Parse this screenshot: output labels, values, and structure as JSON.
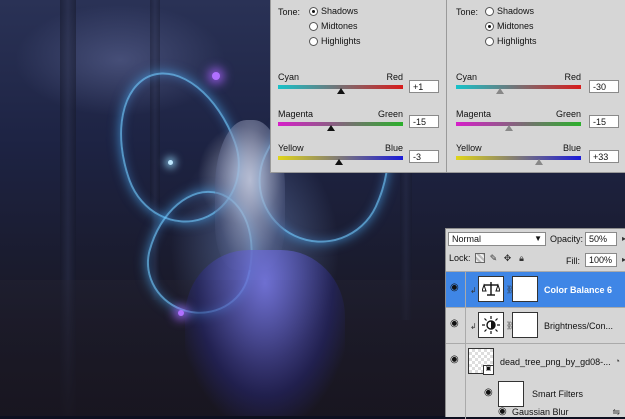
{
  "color_balance_left": {
    "tone_label": "Tone:",
    "tones": [
      {
        "label": "Shadows",
        "selected": true
      },
      {
        "label": "Midtones",
        "selected": false
      },
      {
        "label": "Highlights",
        "selected": false
      }
    ],
    "sliders": [
      {
        "left": "Cyan",
        "right": "Red",
        "value": "+1",
        "level_percent": 50.5
      },
      {
        "left": "Magenta",
        "right": "Green",
        "value": "-15",
        "level_percent": 42.5
      },
      {
        "left": "Yellow",
        "right": "Blue",
        "value": "-3",
        "level_percent": 48.5
      }
    ]
  },
  "color_balance_right": {
    "tone_label": "Tone:",
    "tones": [
      {
        "label": "Shadows",
        "selected": false
      },
      {
        "label": "Midtones",
        "selected": true
      },
      {
        "label": "Highlights",
        "selected": false
      }
    ],
    "sliders": [
      {
        "left": "Cyan",
        "right": "Red",
        "value": "-30",
        "level_percent": 35
      },
      {
        "left": "Magenta",
        "right": "Green",
        "value": "-15",
        "level_percent": 42.5
      },
      {
        "left": "Yellow",
        "right": "Blue",
        "value": "+33",
        "level_percent": 66.5
      }
    ]
  },
  "layers_panel": {
    "blend_mode": "Normal",
    "opacity_label": "Opacity:",
    "opacity_value": "50%",
    "lock_label": "Lock:",
    "fill_label": "Fill:",
    "fill_value": "100%",
    "layers": [
      {
        "name": "Color Balance 6",
        "selected": true,
        "kind": "adjustment",
        "icon": "balance-scale-icon"
      },
      {
        "name": "Brightness/Con...",
        "selected": false,
        "kind": "adjustment",
        "icon": "sun-icon"
      },
      {
        "name": "dead_tree_png_by_gd08-...",
        "selected": false,
        "kind": "smart-object"
      }
    ],
    "smart_filters_label": "Smart Filters",
    "filter_name": "Gaussian Blur"
  },
  "colors": {
    "selection": "#3f86e6",
    "panel_bg": "#d6d6d6"
  }
}
